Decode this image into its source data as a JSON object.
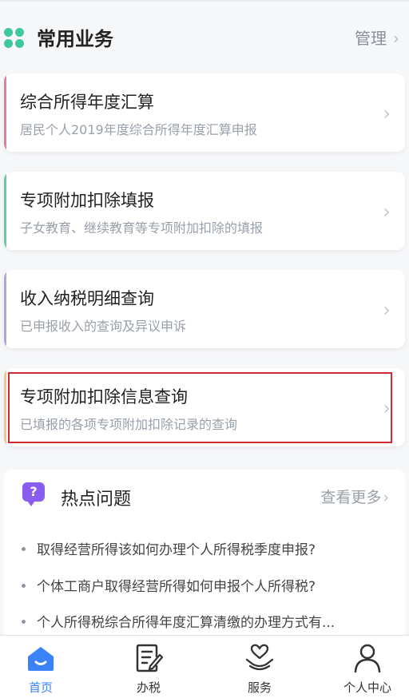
{
  "section": {
    "title": "常用业务",
    "manage_label": "管理",
    "chevron": "›",
    "icon": "clover-icon",
    "icon_color": "#3ec7a0"
  },
  "cards": [
    {
      "title": "综合所得年度汇算",
      "desc": "居民个人2019年度综合所得年度汇算申报",
      "accent": "#e87b95"
    },
    {
      "title": "专项附加扣除填报",
      "desc": "子女教育、继续教育等专项附加扣除的填报",
      "accent": "#5bd0a1"
    },
    {
      "title": "收入纳税明细查询",
      "desc": "已申报收入的查询及异议申诉",
      "accent": "#b4a0e6"
    },
    {
      "title": "专项附加扣除信息查询",
      "desc": "已填报的各项专项附加扣除记录的查询",
      "accent": "#f2c97a",
      "highlighted": true
    }
  ],
  "hot": {
    "icon_char": "?",
    "title": "热点问题",
    "more_label": "查看更多",
    "items": [
      "取得经营所得该如何办理个人所得税季度申报?",
      "个体工商户取得经营所得如何申报个人所得税?",
      "个人所得税综合所得年度汇算清缴的办理方式有..."
    ]
  },
  "tabs": [
    {
      "label": "首页",
      "icon": "home-icon",
      "active": true
    },
    {
      "label": "办税",
      "icon": "edit-document-icon",
      "active": false
    },
    {
      "label": "服务",
      "icon": "heart-hand-icon",
      "active": false
    },
    {
      "label": "个人中心",
      "icon": "person-icon",
      "active": false
    }
  ],
  "colors": {
    "accent_blue": "#3b82f6",
    "highlight_red": "#d02a36",
    "question_purple": "#8a5cf0"
  }
}
